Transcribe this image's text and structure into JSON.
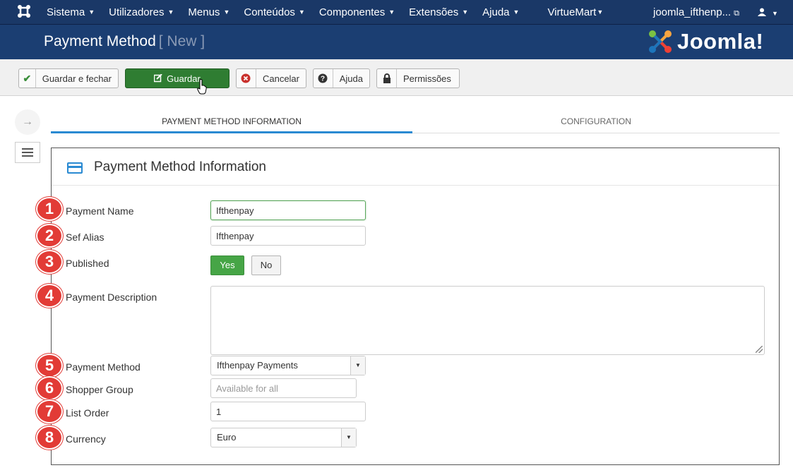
{
  "navbar": {
    "menu": [
      {
        "label": "Sistema"
      },
      {
        "label": "Utilizadores"
      },
      {
        "label": "Menus"
      },
      {
        "label": "Conteúdos"
      },
      {
        "label": "Componentes"
      },
      {
        "label": "Extensões"
      },
      {
        "label": "Ajuda"
      },
      {
        "label": "VirtueMart"
      }
    ],
    "user_site": "joomla_ifthenp..."
  },
  "header": {
    "title": "Payment Method",
    "subtitle": "[ New ]",
    "logo_text": "Joomla!"
  },
  "toolbar": {
    "save_close": "Guardar e fechar",
    "save": "Guardar",
    "cancel": "Cancelar",
    "help": "Ajuda",
    "permissions": "Permissões"
  },
  "tabs": [
    {
      "label": "PAYMENT METHOD INFORMATION",
      "active": true
    },
    {
      "label": "CONFIGURATION",
      "active": false
    }
  ],
  "panel": {
    "title": "Payment Method Information"
  },
  "form": {
    "payment_name": {
      "badge": "1",
      "label": "Payment Name",
      "value": "Ifthenpay"
    },
    "sef_alias": {
      "badge": "2",
      "label": "Sef Alias",
      "value": "Ifthenpay"
    },
    "published": {
      "badge": "3",
      "label": "Published",
      "yes": "Yes",
      "no": "No",
      "selected": "Yes"
    },
    "payment_description": {
      "badge": "4",
      "label": "Payment Description",
      "value": ""
    },
    "payment_method": {
      "badge": "5",
      "label": "Payment Method",
      "value": "Ifthenpay Payments"
    },
    "shopper_group": {
      "badge": "6",
      "label": "Shopper Group",
      "placeholder": "Available for all"
    },
    "list_order": {
      "badge": "7",
      "label": "List Order",
      "value": "1"
    },
    "currency": {
      "badge": "8",
      "label": "Currency",
      "value": "Euro"
    }
  },
  "colors": {
    "navbar": "#1a3867",
    "header": "#1b3e72",
    "primary_button": "#2f7d32",
    "badge": "#e23b36",
    "tab_active": "#2a8ad2"
  },
  "icons": {
    "joomla": "joomla-logo-icon",
    "save_close": "check-icon",
    "save": "edit-icon",
    "cancel": "cancel-icon",
    "help": "question-icon",
    "permissions": "lock-icon"
  }
}
